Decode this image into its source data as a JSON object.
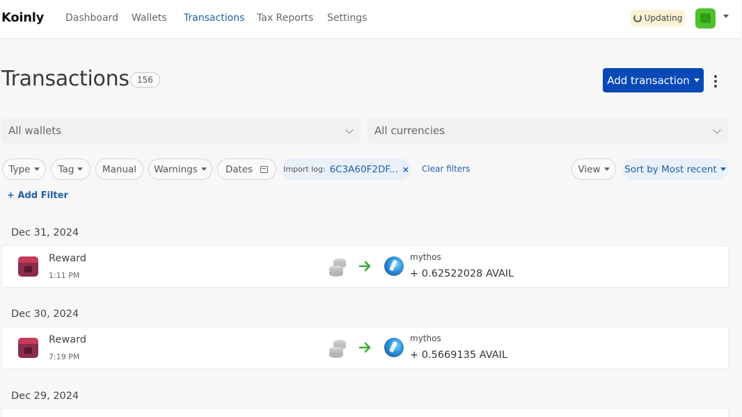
{
  "nav": {
    "logo": "Koinly",
    "links": [
      "Dashboard",
      "Wallets",
      "Transactions",
      "Tax Reports",
      "Settings"
    ],
    "active": "Transactions",
    "updating": "Updating"
  },
  "header": {
    "title": "Transactions",
    "count": "156",
    "add_button": "Add transaction"
  },
  "selects": {
    "wallets": "All wallets",
    "currencies": "All currencies"
  },
  "filters": {
    "type": "Type",
    "tag": "Tag",
    "manual": "Manual",
    "warnings": "Warnings",
    "dates": "Dates",
    "import_label": "Import log:",
    "import_value": "6C3A60F2DF...",
    "clear": "Clear filters",
    "view": "View",
    "sort": "Sort by Most recent",
    "add_filter": "+ Add Filter"
  },
  "groups": [
    {
      "date": "Dec 31, 2024",
      "tx": {
        "type": "Reward",
        "time": "1:11 PM",
        "wallet": "mythos",
        "amount": "+ 0.62522028 AVAIL"
      }
    },
    {
      "date": "Dec 30, 2024",
      "tx": {
        "type": "Reward",
        "time": "7:19 PM",
        "wallet": "mythos",
        "amount": "+ 0.5669135 AVAIL"
      }
    },
    {
      "date": "Dec 29, 2024"
    }
  ],
  "colors": {
    "primary": "#0849b8",
    "link": "#1f5fa8",
    "arrow": "#3aad2e"
  }
}
